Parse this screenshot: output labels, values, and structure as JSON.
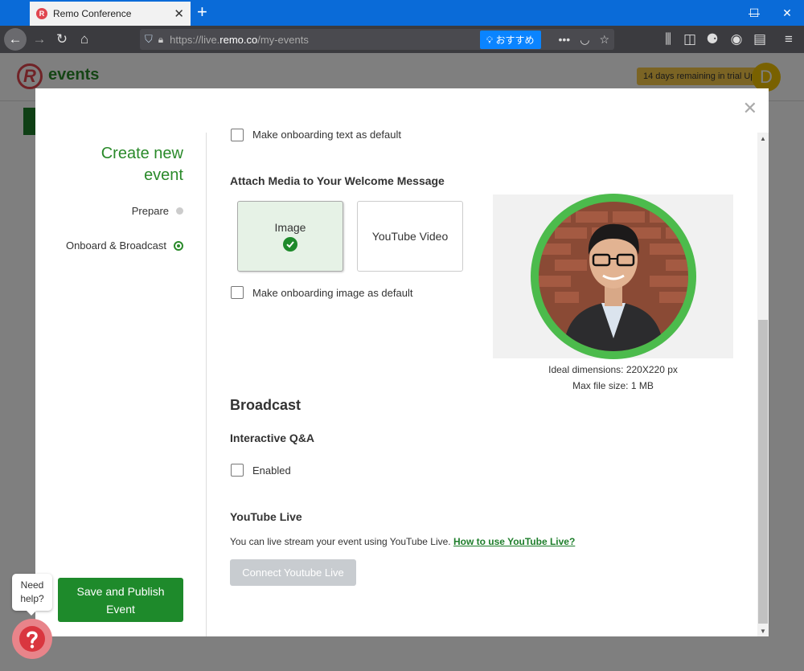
{
  "browser": {
    "tab_title": "Remo Conference",
    "url_prefix": "https://live.",
    "url_domain": "remo.co",
    "url_path": "/my-events",
    "reader_label": "おすすめ"
  },
  "page": {
    "logo_text": "events",
    "trial_text": "14 days remaining in trial  Up",
    "avatar_letter": "D"
  },
  "modal": {
    "sidebar": {
      "title_line1": "Create new",
      "title_line2": "event",
      "steps": [
        {
          "label": "Prepare",
          "active": false
        },
        {
          "label": "Onboard & Broadcast",
          "active": true
        }
      ],
      "save_line1": "Save and Publish",
      "save_line2": "Event"
    },
    "onboard": {
      "default_text_label": "Make onboarding text as default",
      "attach_title": "Attach Media to Your Welcome Message",
      "media_options": [
        {
          "label": "Image",
          "selected": true
        },
        {
          "label": "YouTube Video",
          "selected": false
        }
      ],
      "default_image_label": "Make onboarding image as default",
      "ideal_dimensions": "Ideal dimensions: 220X220 px",
      "max_size": "Max file size: 1 MB"
    },
    "broadcast": {
      "title": "Broadcast",
      "qa_title": "Interactive Q&A",
      "enabled_label": "Enabled",
      "yt_title": "YouTube Live",
      "yt_text": "You can live stream your event using YouTube Live. ",
      "yt_link": "How to use YouTube Live?",
      "connect_label": "Connect Youtube Live"
    }
  },
  "help": {
    "line1": "Need",
    "line2": "help?"
  },
  "colors": {
    "brand_green": "#1e8a2b",
    "browser_blue": "#0a6bd8",
    "remo_red": "#e0464f"
  }
}
